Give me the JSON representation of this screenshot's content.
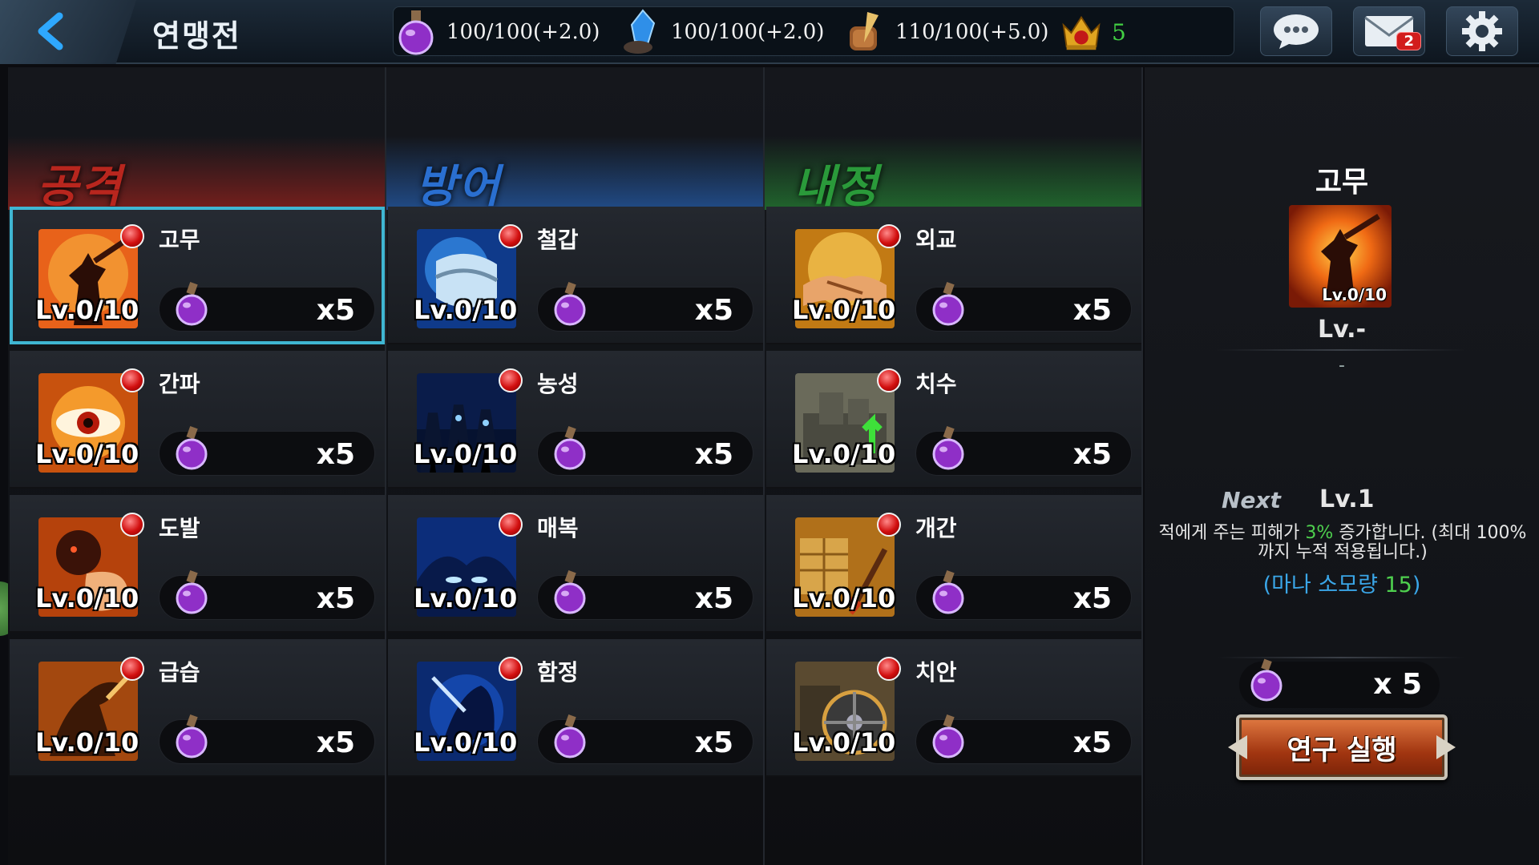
{
  "header": {
    "title": "연맹전",
    "resources": [
      {
        "icon": "mana-potion-icon",
        "value": "100/100(+2.0)"
      },
      {
        "icon": "blue-crystal-icon",
        "value": "100/100(+2.0)"
      },
      {
        "icon": "scroll-quill-icon",
        "value": "110/100(+5.0)"
      }
    ],
    "crown": {
      "icon": "crown-icon",
      "value": "5"
    },
    "mail_badge": "2"
  },
  "columns": [
    {
      "label": "공격",
      "color": "#b8261e",
      "items": [
        {
          "name": "고무",
          "level": "Lv.0/10",
          "cost": "x5"
        },
        {
          "name": "간파",
          "level": "Lv.0/10",
          "cost": "x5"
        },
        {
          "name": "도발",
          "level": "Lv.0/10",
          "cost": "x5"
        },
        {
          "name": "급습",
          "level": "Lv.0/10",
          "cost": "x5"
        }
      ]
    },
    {
      "label": "방어",
      "color": "#2a6fd0",
      "items": [
        {
          "name": "철갑",
          "level": "Lv.0/10",
          "cost": "x5"
        },
        {
          "name": "농성",
          "level": "Lv.0/10",
          "cost": "x5"
        },
        {
          "name": "매복",
          "level": "Lv.0/10",
          "cost": "x5"
        },
        {
          "name": "함정",
          "level": "Lv.0/10",
          "cost": "x5"
        }
      ]
    },
    {
      "label": "내정",
      "color": "#2a9a3a",
      "items": [
        {
          "name": "외교",
          "level": "Lv.0/10",
          "cost": "x5"
        },
        {
          "name": "치수",
          "level": "Lv.0/10",
          "cost": "x5"
        },
        {
          "name": "개간",
          "level": "Lv.0/10",
          "cost": "x5"
        },
        {
          "name": "치안",
          "level": "Lv.0/10",
          "cost": "x5"
        }
      ]
    }
  ],
  "detail": {
    "name": "고무",
    "icon_level": "Lv.0/10",
    "current_level": "Lv.-",
    "current_effect": "-",
    "next_label": "Next",
    "next_level": "Lv.1",
    "desc_pre": "적에게 주는 피해가 ",
    "desc_pct": "3%",
    "desc_post": " 증가합니다. (최대 100%까지 누적 적용됩니다.)",
    "mana_pre": "(마나 소모량 ",
    "mana_val": "15",
    "mana_post": ")",
    "cost": "x 5",
    "button": "연구 실행"
  }
}
